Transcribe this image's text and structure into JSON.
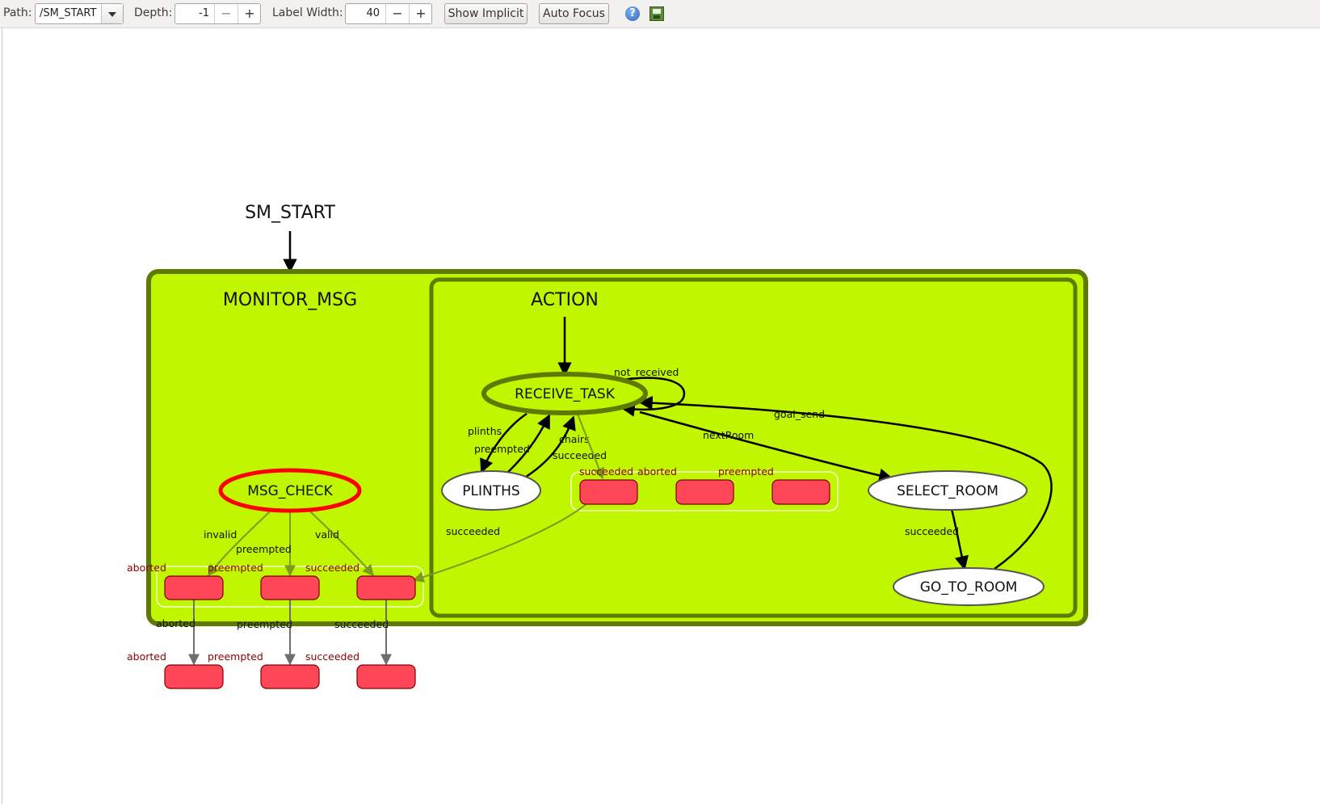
{
  "toolbar": {
    "path_label": "Path:",
    "path_value": "/SM_START",
    "depth_label": "Depth:",
    "depth_value": "-1",
    "label_width_label": "Label Width:",
    "label_width_value": "40",
    "minus": "−",
    "plus": "+",
    "show_implicit": "Show Implicit",
    "auto_focus": "Auto Focus",
    "help_glyph": "?",
    "help_icon": "help-icon",
    "save_icon": "save-icon"
  },
  "graph": {
    "root": "SM_START",
    "containers": {
      "monitor_msg": "MONITOR_MSG",
      "action": "ACTION"
    },
    "states": {
      "msg_check": "MSG_CHECK",
      "receive_task": "RECEIVE_TASK",
      "plinths": "PLINTHS",
      "select_room": "SELECT_ROOM",
      "go_to_room": "GO_TO_ROOM"
    },
    "transitions": {
      "invalid": "invalid",
      "preempted": "preempted",
      "valid": "valid",
      "aborted": "aborted",
      "succeeded": "succeeded",
      "not_received": "not_received",
      "goal_send": "goal_send",
      "nextRoom": "nextRoom",
      "plinths": "plinths",
      "chairs": "chairs"
    },
    "outcomes": {
      "aborted": "aborted",
      "preempted": "preempted",
      "succeeded": "succeeded"
    },
    "colors": {
      "container_fill": "#bff600",
      "container_stroke": "#5f7a00",
      "active_state_stroke": "#ff0000",
      "outcome_fill": "#ff4757",
      "outcome_label": "#8b0000"
    }
  }
}
